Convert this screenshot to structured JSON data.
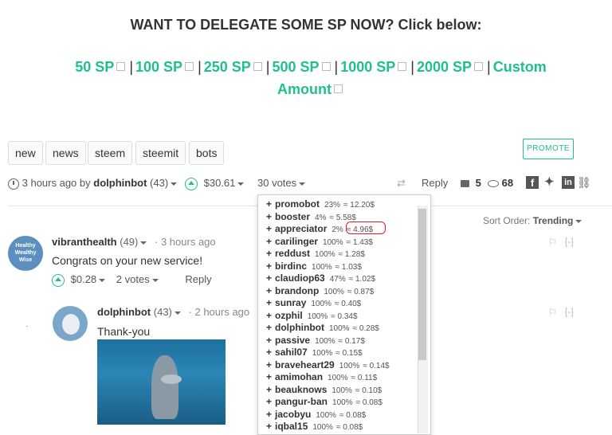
{
  "banner": {
    "heading": "WANT TO DELEGATE SOME SP NOW? Click below:",
    "links": [
      "50 SP",
      "100 SP",
      "250 SP",
      "500 SP",
      "1000 SP",
      "2000 SP",
      "Custom Amount"
    ],
    "separator": "|",
    "accent_color": "#1fbf8f"
  },
  "tags": [
    "new",
    "news",
    "steem",
    "steemit",
    "bots"
  ],
  "promote_label": "PROMOTE",
  "post_meta": {
    "time": "3 hours ago",
    "by_label": "by",
    "author": "dolphinbot",
    "reputation": "(43)",
    "payout": "$30.61",
    "votes_label": "30 votes",
    "reply_label": "Reply",
    "comments_count": "5",
    "views_count": "68",
    "share_icons": [
      "facebook-icon",
      "twitter-icon",
      "linkedin-icon",
      "link-icon"
    ]
  },
  "sort": {
    "label": "Sort Order:",
    "value": "Trending"
  },
  "comments": [
    {
      "author": "vibranthealth",
      "reputation": "(49)",
      "time": "3 hours ago",
      "body": "Congrats on your new service!",
      "payout": "$0.28",
      "votes_label": "2 votes",
      "reply_label": "Reply",
      "collapse": "[-]",
      "avatar_text": "Healthy Wealthy Wise"
    },
    {
      "author": "dolphinbot",
      "reputation": "(43)",
      "time": "2 hours ago",
      "body": "Thank-you",
      "collapse": "[-]"
    }
  ],
  "voters": [
    {
      "name": "promobot",
      "pct": "23%",
      "value": "≈ 12.20$"
    },
    {
      "name": "booster",
      "pct": "4%",
      "value": "≈ 5.58$"
    },
    {
      "name": "appreciator",
      "pct": "2%",
      "value": "≈ 4.96$"
    },
    {
      "name": "carilinger",
      "pct": "100%",
      "value": "≈ 1.43$"
    },
    {
      "name": "reddust",
      "pct": "100%",
      "value": "≈ 1.28$"
    },
    {
      "name": "birdinc",
      "pct": "100%",
      "value": "≈ 1.03$"
    },
    {
      "name": "claudiop63",
      "pct": "47%",
      "value": "≈ 1.02$"
    },
    {
      "name": "brandonp",
      "pct": "100%",
      "value": "≈ 0.87$"
    },
    {
      "name": "sunray",
      "pct": "100%",
      "value": "≈ 0.40$"
    },
    {
      "name": "ozphil",
      "pct": "100%",
      "value": "≈ 0.34$"
    },
    {
      "name": "dolphinbot",
      "pct": "100%",
      "value": "≈ 0.28$"
    },
    {
      "name": "passive",
      "pct": "100%",
      "value": "≈ 0.17$"
    },
    {
      "name": "sahil07",
      "pct": "100%",
      "value": "≈ 0.15$"
    },
    {
      "name": "braveheart29",
      "pct": "100%",
      "value": "≈ 0.14$"
    },
    {
      "name": "amimohan",
      "pct": "100%",
      "value": "≈ 0.11$"
    },
    {
      "name": "beauknows",
      "pct": "100%",
      "value": "≈ 0.10$"
    },
    {
      "name": "pangur-ban",
      "pct": "100%",
      "value": "≈ 0.08$"
    },
    {
      "name": "jacobyu",
      "pct": "100%",
      "value": "≈ 0.08$"
    },
    {
      "name": "iqbal15",
      "pct": "100%",
      "value": "≈ 0.08$"
    }
  ],
  "voter_prefix": "+"
}
